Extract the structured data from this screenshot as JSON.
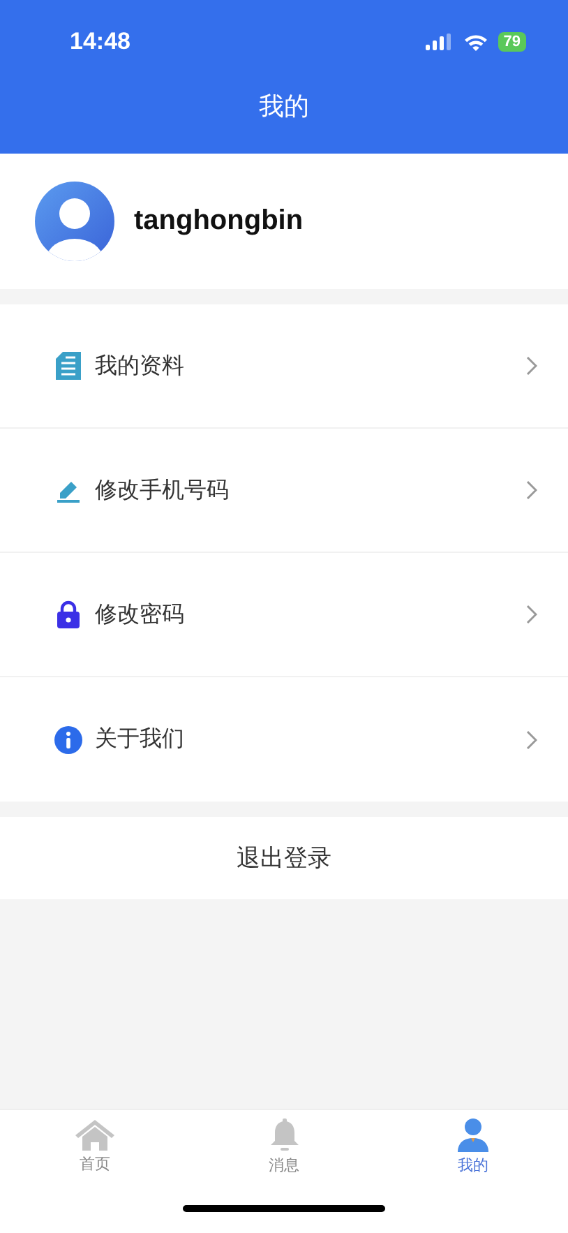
{
  "status_bar": {
    "time": "14:48",
    "battery": "79"
  },
  "header": {
    "title": "我的"
  },
  "profile": {
    "username": "tanghongbin"
  },
  "menu": [
    {
      "kind": "document",
      "label": "我的资料"
    },
    {
      "kind": "edit",
      "label": "修改手机号码"
    },
    {
      "kind": "lock",
      "label": "修改密码"
    },
    {
      "kind": "info",
      "label": "关于我们"
    }
  ],
  "logout": {
    "label": "退出登录"
  },
  "tabs": [
    {
      "kind": "home",
      "label": "首页",
      "selected": false
    },
    {
      "kind": "bell",
      "label": "消息",
      "selected": false
    },
    {
      "kind": "person",
      "label": "我的",
      "selected": true
    }
  ]
}
